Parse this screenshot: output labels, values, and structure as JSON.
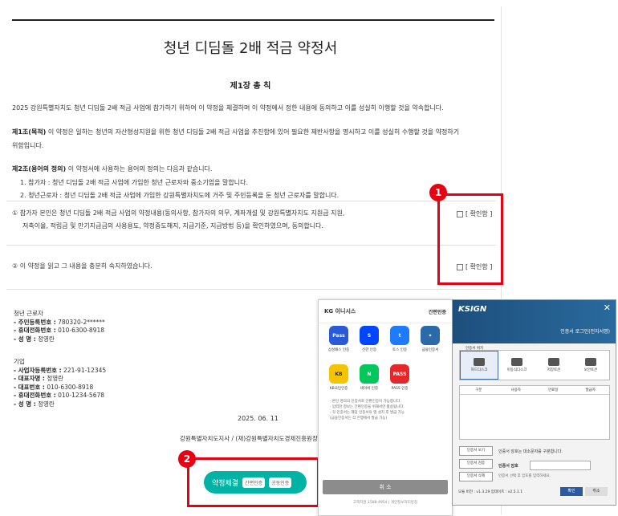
{
  "document": {
    "title": "청년 디딤돌 2배 적금 약정서",
    "chapter": "제1장 총 칙",
    "intro": "2025 강원특별자치도 청년 디딤돌 2배 적금 사업에 참가하기 위하여 이 약정을 체결하며 이 약정에서 정한 내용에 동의하고 이를 성실히 이행할 것을 약속합니다.",
    "art1_title": "제1조(목적)",
    "art1_text": " 이 약정은 일하는 청년의 자산형성지원을 위한 청년 디딤돌 2배 적금 사업을 추진함에 있어 필요한 제반사항을 명시하고 이를 성실히 수행할 것을 약정하기",
    "art1_text2": "위함입니다.",
    "art2_title": "제2조(용어의 정의)",
    "art2_text": " 이 약정서에 사용하는 용어의 정의는 다음과 같습니다.",
    "def1": "1.  참가자 : 청년 디딤돌 2배 적금 사업에 가입한 청년 근로자와 중소기업을 말합니다.",
    "def2": "2.  청년근로자 : 청년 디딤돌 2배 적금 사업에 가입한 강원특별자치도에 거주 및 주민등록을 둔 청년 근로자를 말합니다."
  },
  "agreements": [
    {
      "line1": "①  참가자 본인은 청년 디딤돌 2배 적금 사업의 약정내용(동의사항, 참가자의 의무, 계좌개설 및 강원특별자치도 지원금 지원,",
      "line2": "저축이율, 적립금 및 만기지급금의 사용용도, 약정중도해지, 지급기준, 지급방법 등)을 확인하였으며, 동의합니다.",
      "check_label": "[ 확인함 ]"
    },
    {
      "line1": "②  이 약정을 읽고 그 내용을 충분히 숙지하였습니다.",
      "check_label": "[ 확인함 ]"
    }
  ],
  "annotations": [
    "1",
    "2"
  ],
  "youth_worker": {
    "heading": "청년 근로자",
    "rrn_label": "- 주민등록번호 :",
    "rrn": " 780320-2******",
    "phone_label": "- 휴대전화번호 :",
    "phone": " 010-6300-8918",
    "name_label": "- 성 명 :",
    "name": " 정영란"
  },
  "company": {
    "heading": "기업",
    "biz_label": "- 사업자등록번호 :",
    "biz": " 221-91-12345",
    "rep_label": "- 대표자명 :",
    "rep": " 정영란",
    "tel_label": "- 대표번호 :",
    "tel": " 010-6300-8918",
    "mobile_label": "- 휴대전화번호 :",
    "mobile": " 010-1234-5678",
    "name_label": "- 성 명 :",
    "name": " 정영란"
  },
  "date": "2025. 06. 11",
  "issuer": "강원특별자치도지사 / (재)강원특별자치도경제진흥원장",
  "sign_button": {
    "label": "약정체결",
    "mini1": "간편인증",
    "mini2": "공동인증"
  },
  "kg_popup": {
    "logo": "KG 이니시스",
    "simple_auth": "간편인증",
    "providers": [
      {
        "name": "삼성패스 인증",
        "icon": "Pass",
        "color": "#2a5bd7"
      },
      {
        "name": "신한 인증",
        "icon": "S",
        "color": "#0046ff"
      },
      {
        "name": "토스 인증",
        "icon": "t",
        "color": "#1e7bff"
      },
      {
        "name": "금융인증서",
        "icon": "✦",
        "color": "#2b6aa8"
      },
      {
        "name": "KB국민인증",
        "icon": "KB",
        "color": "#f5c400"
      },
      {
        "name": "네이버 인증",
        "icon": "N",
        "color": "#03c75a"
      },
      {
        "name": "PASS 인증",
        "icon": "PASS",
        "color": "#e5262a"
      }
    ],
    "notes": [
      "· 본인 명의의 인증서로 간편인증이 가능합니다.",
      "· 입력한 정보는 간편인증을 위해서만 활용됩니다.",
      "· 각 인증서는 해당 인증서의 앱 설치 후 발급 가능",
      "  (금융인증서는 각 은행에서 발급 가능)"
    ],
    "cancel": "취 소",
    "footer": "고객지원 1588-4954 | 개인정보처리방침"
  },
  "ksign_popup": {
    "brand": "KSIGN",
    "subtitle": "인증서 로그인(전자서명)",
    "location_label": "인증서 위치",
    "locations": [
      "하드디스크",
      "이동식디스크",
      "저장토큰",
      "보안토큰"
    ],
    "columns": [
      "구분",
      "사용자",
      "만료일",
      "발급자"
    ],
    "side_buttons": [
      "인증서 보기",
      "인증서 검증",
      "인증서 삭제"
    ],
    "message": "인증서 암호는 대소문자를 구분합니다.",
    "password_label": "인증서 암호",
    "hint": "인증서 선택 후 암호를 입력하세요.",
    "version": "모듈 버전 : v1.3.29  업데이트 : v2.5.1.1",
    "ok": "확인",
    "cancel": "취소"
  }
}
